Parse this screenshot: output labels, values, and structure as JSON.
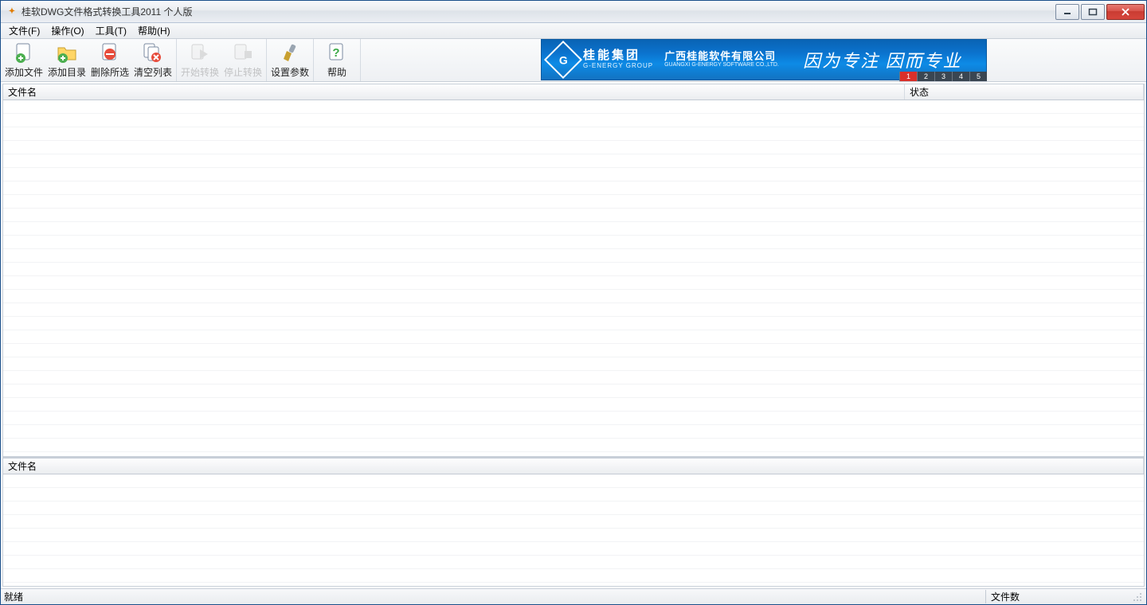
{
  "window": {
    "title": "桂软DWG文件格式转换工具2011 个人版"
  },
  "menu": {
    "file": "文件(F)",
    "operate": "操作(O)",
    "tools": "工具(T)",
    "help": "帮助(H)"
  },
  "toolbar": {
    "add_file": "添加文件",
    "add_dir": "添加目录",
    "delete_sel": "删除所选",
    "clear_list": "清空列表",
    "start_conv": "开始转换",
    "stop_conv": "停止转换",
    "set_params": "设置参数",
    "help": "帮助"
  },
  "banner": {
    "group_cn": "桂能集团",
    "group_en": "G-ENERGY GROUP",
    "company_cn": "广西桂能软件有限公司",
    "company_en": "GUANGXI G-ENERGY SOFTWARE CO.,LTD.",
    "slogan": "因为专注  因而专业",
    "pages": [
      "1",
      "2",
      "3",
      "4",
      "5"
    ],
    "active_page": "1"
  },
  "columns": {
    "filename": "文件名",
    "status": "状态",
    "filename2": "文件名"
  },
  "statusbar": {
    "ready": "就绪",
    "file_count_label": "文件数"
  },
  "colors": {
    "accent_red": "#d9302a",
    "banner_blue": "#0b74cf"
  }
}
